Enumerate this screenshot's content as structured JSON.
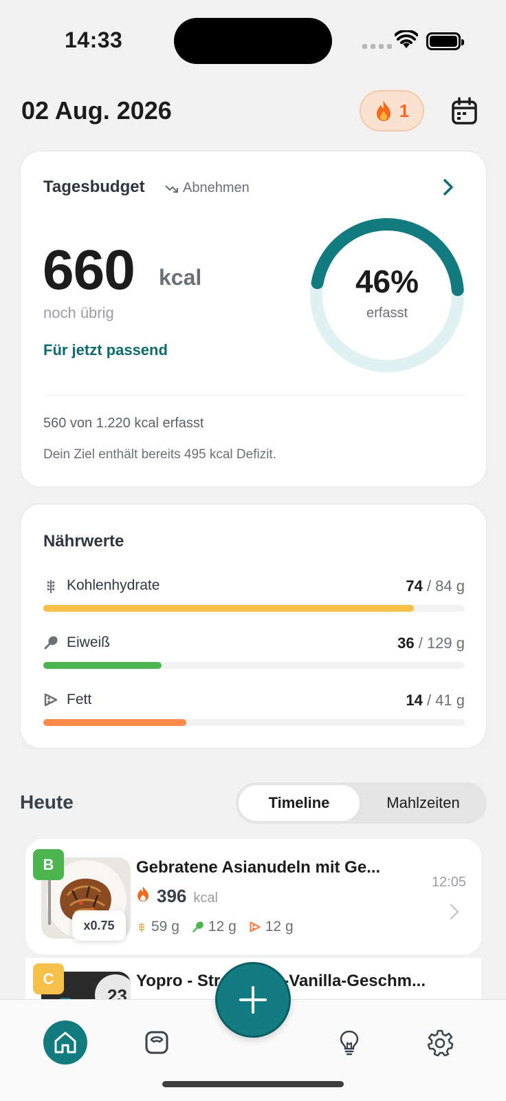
{
  "status_bar": {
    "time": "14:33"
  },
  "header": {
    "date": "02 Aug. 2026",
    "streak_count": "1"
  },
  "budget": {
    "title": "Tagesbudget",
    "mode": "Abnehmen",
    "remaining_value": "660",
    "unit": "kcal",
    "remaining_label": "noch übrig",
    "fit_link": "Für jetzt passend",
    "percent_text": "46%",
    "percent_value": 0.46,
    "percent_label": "erfasst",
    "logged_text": "560 von 1.220 kcal erfasst",
    "deficit_text": "Dein Ziel enthält bereits 495 kcal Defizit."
  },
  "nutrients": {
    "title": "Nährwerte",
    "items": [
      {
        "label": "Kohlenhydrate",
        "current": "74",
        "target": " / 84 g",
        "progress": 0.88,
        "color": "#f6bf4a"
      },
      {
        "label": "Eiweiß",
        "current": "36",
        "target": " / 129 g",
        "progress": 0.28,
        "color": "#4cb54f"
      },
      {
        "label": "Fett",
        "current": "14",
        "target": " / 41 g",
        "progress": 0.34,
        "color": "#ff8a4c"
      }
    ]
  },
  "today": {
    "title": "Heute",
    "segment_active": "Timeline",
    "segment_inactive": "Mahlzeiten"
  },
  "meals": [
    {
      "badge": "B",
      "badge_color": "#4cb54f",
      "name": "Gebratene Asianudeln mit Ge...",
      "kcal": "396",
      "kcal_unit": "kcal",
      "carbs": "59 g",
      "protein": "12 g",
      "fat": "12 g",
      "time": "12:05",
      "portion": "x0.75"
    },
    {
      "badge": "C",
      "badge_color": "#f6bf4a",
      "name": "Yopro - Strawberry-Vanilla-Geschm..."
    }
  ],
  "colors": {
    "accent": "#117b80",
    "ring_track": "#e0f1f2",
    "streak_bg": "#fbe1cf"
  }
}
